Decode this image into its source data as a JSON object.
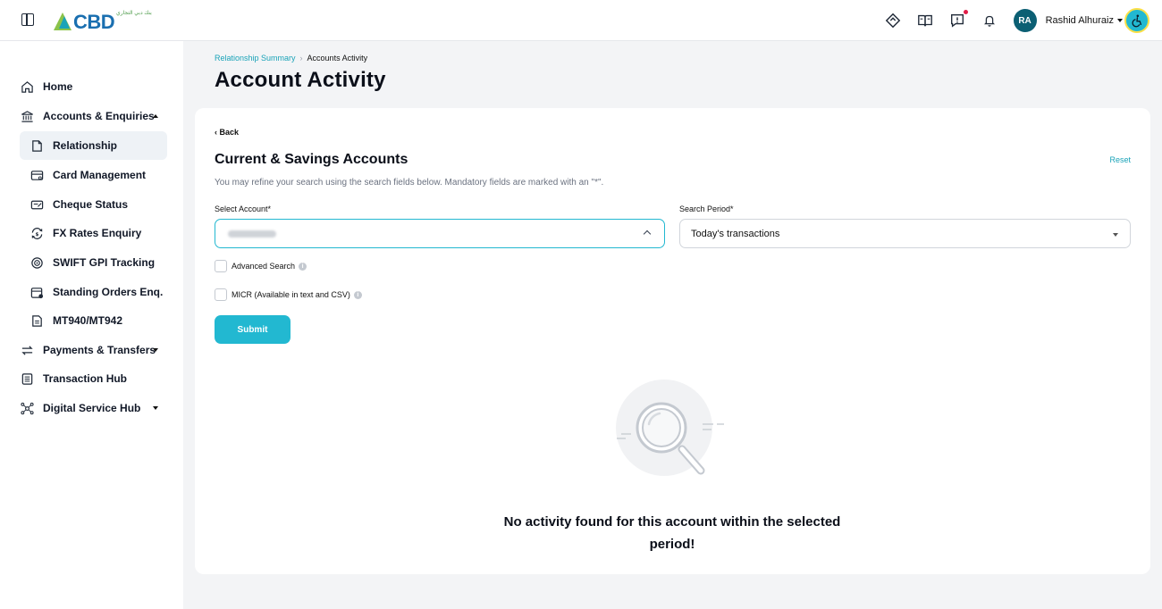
{
  "header": {
    "logo_text": "CBD",
    "logo_subtext": "بنك دبي التجاري",
    "user_initials": "RA",
    "user_name": "Rashid Alhuraiz"
  },
  "sidebar": {
    "items": [
      {
        "label": "Home",
        "icon": "home-icon"
      },
      {
        "label": "Accounts & Enquiries",
        "icon": "bank-icon",
        "expanded": true
      },
      {
        "label": "Relationship",
        "icon": "document-icon",
        "active": true
      },
      {
        "label": "Card Management",
        "icon": "card-icon"
      },
      {
        "label": "Cheque Status",
        "icon": "cheque-icon"
      },
      {
        "label": "FX Rates Enquiry",
        "icon": "currency-exchange-icon"
      },
      {
        "label": "SWIFT GPI Tracking",
        "icon": "tracking-icon"
      },
      {
        "label": "Standing Orders Enq.",
        "icon": "calendar-icon"
      },
      {
        "label": "MT940/MT942",
        "icon": "statement-icon"
      },
      {
        "label": "Payments & Transfers",
        "icon": "transfer-icon"
      },
      {
        "label": "Transaction Hub",
        "icon": "list-icon"
      },
      {
        "label": "Digital Service Hub",
        "icon": "network-icon"
      }
    ]
  },
  "main": {
    "breadcrumb": {
      "parent": "Relationship Summary",
      "separator": "›",
      "current": "Accounts Activity"
    },
    "title": "Account Activity",
    "card": {
      "back_label": "‹ Back",
      "section_title": "Current & Savings Accounts",
      "reset_label": "Reset",
      "hint": "You may refine your search using the search fields below. Mandatory fields are marked with an \"*\".",
      "select_account_label": "Select Account*",
      "search_period_label": "Search Period*",
      "search_period_value": "Today's transactions",
      "advanced_search_label": "Advanced Search",
      "micr_label": "MICR (Available in text and CSV)",
      "submit_label": "Submit",
      "empty_message": "No activity found for this account within the selected period!"
    }
  },
  "colors": {
    "accent": "#22b8d1",
    "link": "#1aa3b8",
    "avatar": "#0b5f73",
    "active_nav": "#eef2f6"
  }
}
